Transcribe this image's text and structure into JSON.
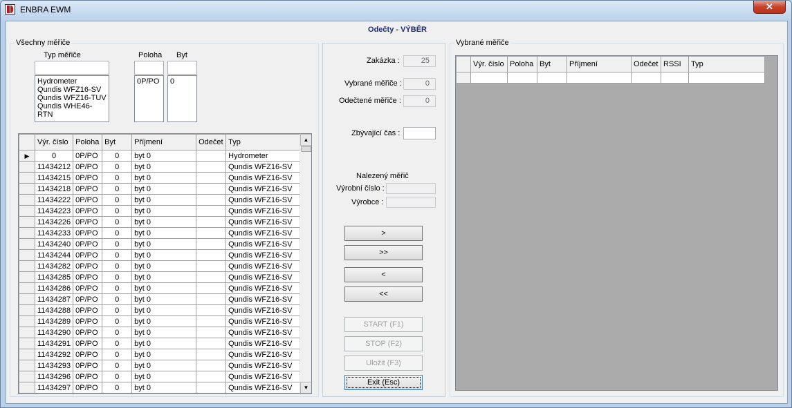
{
  "window": {
    "title": "ENBRA EWM",
    "close_glyph": "✕"
  },
  "form_title": "Odečty - VÝBĚR",
  "left_group": {
    "label": "Všechny měřiče",
    "typ_label": "Typ měřiče",
    "poloha_label": "Poloha",
    "byt_label": "Byt",
    "typ_filter_value": "",
    "poloha_filter_value": "",
    "byt_filter_value": "",
    "typ_items": [
      "Hydrometer",
      "Qundis WFZ16-SV",
      "Qundis WFZ16-TUV",
      "Qundis WHE46-RTN"
    ],
    "poloha_items": [
      "0P/PO"
    ],
    "byt_items": [
      "0"
    ],
    "grid": {
      "columns": [
        "Výr. číslo",
        "Poloha",
        "Byt",
        "Příjmení",
        "Odečet",
        "Typ"
      ],
      "row_indicator": "▶",
      "rows": [
        [
          "0",
          "0P/PO",
          "0",
          "byt 0",
          "",
          "Hydrometer"
        ],
        [
          "11434212",
          "0P/PO",
          "0",
          "byt 0",
          "",
          "Qundis WFZ16-SV"
        ],
        [
          "11434215",
          "0P/PO",
          "0",
          "byt 0",
          "",
          "Qundis WFZ16-SV"
        ],
        [
          "11434218",
          "0P/PO",
          "0",
          "byt 0",
          "",
          "Qundis WFZ16-SV"
        ],
        [
          "11434222",
          "0P/PO",
          "0",
          "byt 0",
          "",
          "Qundis WFZ16-SV"
        ],
        [
          "11434223",
          "0P/PO",
          "0",
          "byt 0",
          "",
          "Qundis WFZ16-SV"
        ],
        [
          "11434226",
          "0P/PO",
          "0",
          "byt 0",
          "",
          "Qundis WFZ16-SV"
        ],
        [
          "11434233",
          "0P/PO",
          "0",
          "byt 0",
          "",
          "Qundis WFZ16-SV"
        ],
        [
          "11434240",
          "0P/PO",
          "0",
          "byt 0",
          "",
          "Qundis WFZ16-SV"
        ],
        [
          "11434244",
          "0P/PO",
          "0",
          "byt 0",
          "",
          "Qundis WFZ16-SV"
        ],
        [
          "11434282",
          "0P/PO",
          "0",
          "byt 0",
          "",
          "Qundis WFZ16-SV"
        ],
        [
          "11434285",
          "0P/PO",
          "0",
          "byt 0",
          "",
          "Qundis WFZ16-SV"
        ],
        [
          "11434286",
          "0P/PO",
          "0",
          "byt 0",
          "",
          "Qundis WFZ16-SV"
        ],
        [
          "11434287",
          "0P/PO",
          "0",
          "byt 0",
          "",
          "Qundis WFZ16-SV"
        ],
        [
          "11434288",
          "0P/PO",
          "0",
          "byt 0",
          "",
          "Qundis WFZ16-SV"
        ],
        [
          "11434289",
          "0P/PO",
          "0",
          "byt 0",
          "",
          "Qundis WFZ16-SV"
        ],
        [
          "11434290",
          "0P/PO",
          "0",
          "byt 0",
          "",
          "Qundis WFZ16-SV"
        ],
        [
          "11434291",
          "0P/PO",
          "0",
          "byt 0",
          "",
          "Qundis WFZ16-SV"
        ],
        [
          "11434292",
          "0P/PO",
          "0",
          "byt 0",
          "",
          "Qundis WFZ16-SV"
        ],
        [
          "11434293",
          "0P/PO",
          "0",
          "byt 0",
          "",
          "Qundis WFZ16-SV"
        ],
        [
          "11434296",
          "0P/PO",
          "0",
          "byt 0",
          "",
          "Qundis WFZ16-SV"
        ],
        [
          "11434297",
          "0P/PO",
          "0",
          "byt 0",
          "",
          "Qundis WFZ16-SV"
        ]
      ]
    }
  },
  "middle": {
    "zakazka_label": "Zakázka :",
    "zakazka_value": "25",
    "vybrane_label": "Vybrané měřiče :",
    "vybrane_value": "0",
    "odectene_label": "Odečtené měřiče :",
    "odectene_value": "0",
    "zbyvajici_label": "Zbývající čas :",
    "zbyvajici_value": "",
    "nalezeny_label": "Nalezený měřič",
    "vyrobni_label": "Výrobní číslo :",
    "vyrobni_value": "",
    "vyrobce_label": "Výrobce :",
    "vyrobce_value": "",
    "buttons": {
      "add_one": ">",
      "add_all": ">>",
      "remove_one": "<",
      "remove_all": "<<",
      "start": "START (F1)",
      "stop": "STOP (F2)",
      "save": "Uložit (F3)",
      "exit": "Exit (Esc)"
    }
  },
  "right_group": {
    "label": "Vybrané měřiče",
    "columns": [
      "Výr. číslo",
      "Poloha",
      "Byt",
      "Příjmení",
      "Odečet",
      "RSSI",
      "Typ"
    ]
  }
}
